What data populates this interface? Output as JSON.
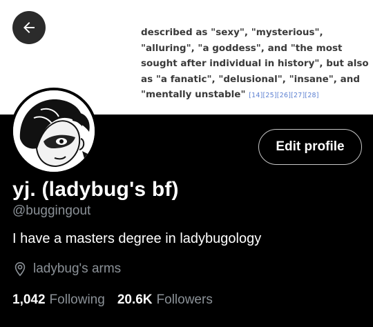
{
  "banner": {
    "quote_text": "described as \"sexy\", \"mysterious\", \"alluring\", \"a goddess\", and \"the most sought after individual in history\", but also as \"a fanatic\", \"delusional\", \"insane\", and \"mentally unstable\"",
    "quote_refs": "[14][25][26][27][28]"
  },
  "header": {
    "back_icon": "arrow-left-icon"
  },
  "profile": {
    "edit_label": "Edit profile",
    "name": "yj. (ladybug's bf)",
    "handle": "@buggingout",
    "bio": "I have a masters degree in ladybugology",
    "location": "ladybug's arms",
    "following_count": "1,042",
    "following_label": "Following",
    "followers_count": "20.6K",
    "followers_label": "Followers"
  },
  "colors": {
    "muted": "#8b9197",
    "background": "#000000",
    "link_ref": "#5b7fd1"
  }
}
